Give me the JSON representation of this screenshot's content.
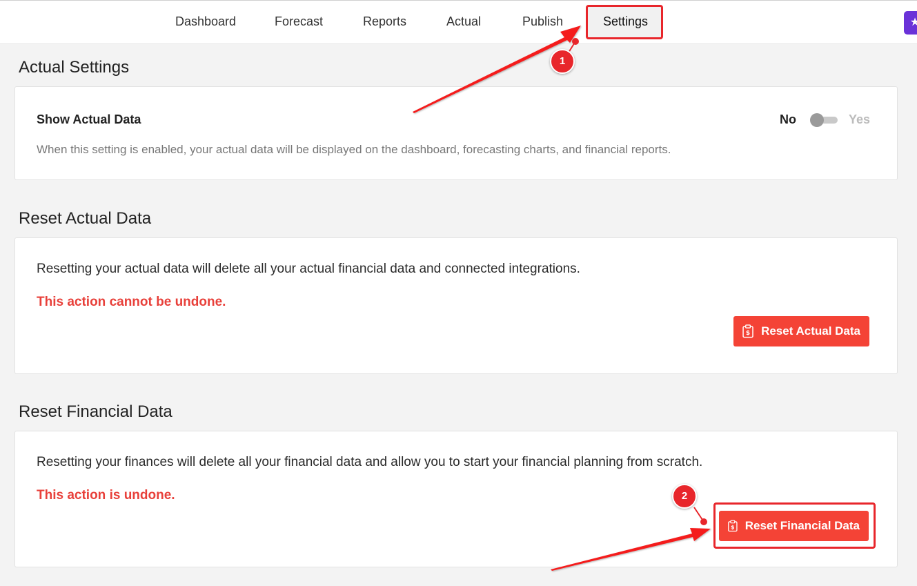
{
  "nav": {
    "items": [
      {
        "label": "Dashboard"
      },
      {
        "label": "Forecast"
      },
      {
        "label": "Reports"
      },
      {
        "label": "Actual"
      },
      {
        "label": "Publish"
      },
      {
        "label": "Settings",
        "active": true
      }
    ]
  },
  "actual_settings": {
    "title": "Actual Settings",
    "setting_label": "Show Actual Data",
    "description": "When this setting is enabled, your actual data will be displayed on the dashboard, forecasting charts, and financial reports.",
    "toggle": {
      "off_label": "No",
      "on_label": "Yes",
      "value": "No"
    }
  },
  "reset_actual": {
    "title": "Reset Actual Data",
    "text": "Resetting your actual data will delete all your actual financial data and connected integrations.",
    "warning": "This action cannot be undone.",
    "button_label": "Reset Actual Data"
  },
  "reset_financial": {
    "title": "Reset Financial Data",
    "text": "Resetting your finances will delete all your financial data and allow you to start your financial planning from scratch.",
    "warning": "This action is undone.",
    "button_label": "Reset Financial Data"
  },
  "annotations": {
    "marker_1": "1",
    "marker_2": "2",
    "color": "#e8262b"
  },
  "colors": {
    "danger": "#f44336",
    "warning_text": "#e8403a",
    "accent": "#6a32d8"
  }
}
